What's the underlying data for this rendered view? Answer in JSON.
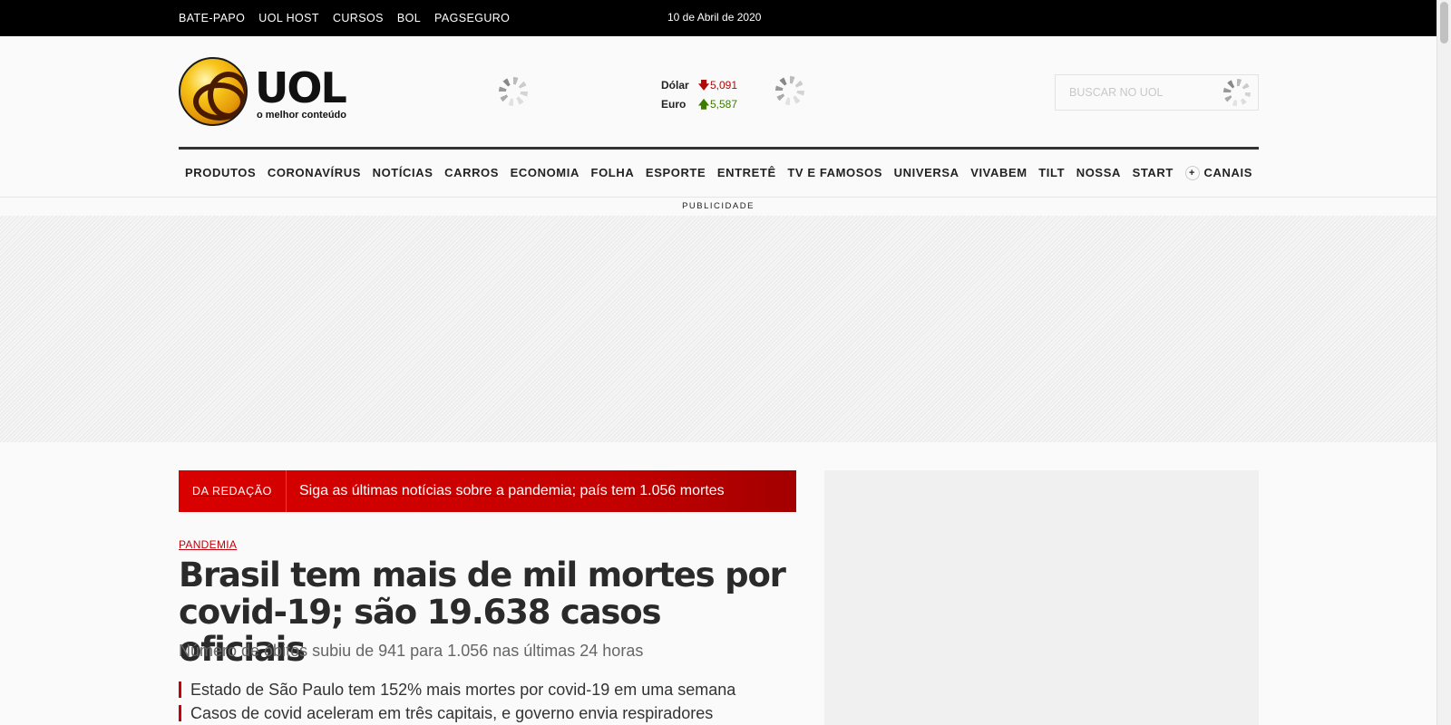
{
  "topbar": {
    "links": [
      "BATE-PAPO",
      "UOL HOST",
      "CURSOS",
      "BOL",
      "PAGSEGURO"
    ],
    "date": "10 de Abril de 2020"
  },
  "header": {
    "logo_text": "UOL",
    "logo_tagline": "o melhor conteúdo",
    "currencies": [
      {
        "name": "Dólar",
        "direction": "down",
        "arrow": "🡇",
        "value": "5,091"
      },
      {
        "name": "Euro",
        "direction": "up",
        "arrow": "🡅",
        "value": "5,587"
      }
    ],
    "search_placeholder": "BUSCAR NO UOL"
  },
  "nav": {
    "items": [
      "PRODUTOS",
      "CORONAVÍRUS",
      "NOTÍCIAS",
      "CARROS",
      "ECONOMIA",
      "FOLHA",
      "ESPORTE",
      "ENTRETÊ",
      "TV E FAMOSOS",
      "UNIVERSA",
      "VIVABEM",
      "TILT",
      "NOSSA",
      "START"
    ],
    "canais_label": "CANAIS",
    "canais_plus": "+"
  },
  "ad": {
    "label": "PUBLICIDADE"
  },
  "breaking": {
    "badge": "DA REDAÇÃO",
    "text": "Siga as últimas notícias sobre a pandemia; país tem 1.056 mortes"
  },
  "main_story": {
    "section": "PANDEMIA",
    "headline": "Brasil tem mais de mil mortes por covid-19; são 19.638 casos oficiais",
    "subhead": "Número de óbitos subiu de 941 para 1.056 nas últimas 24 horas",
    "related": [
      "Estado de São Paulo tem 152% mais mortes por covid-19 em uma semana",
      "Casos de covid aceleram em três capitais, e governo envia respiradores"
    ]
  },
  "colors": {
    "accent_red": "#c4000a",
    "topbar_bg": "#000000",
    "currency_down": "#b10909",
    "currency_up": "#3d7a00"
  }
}
